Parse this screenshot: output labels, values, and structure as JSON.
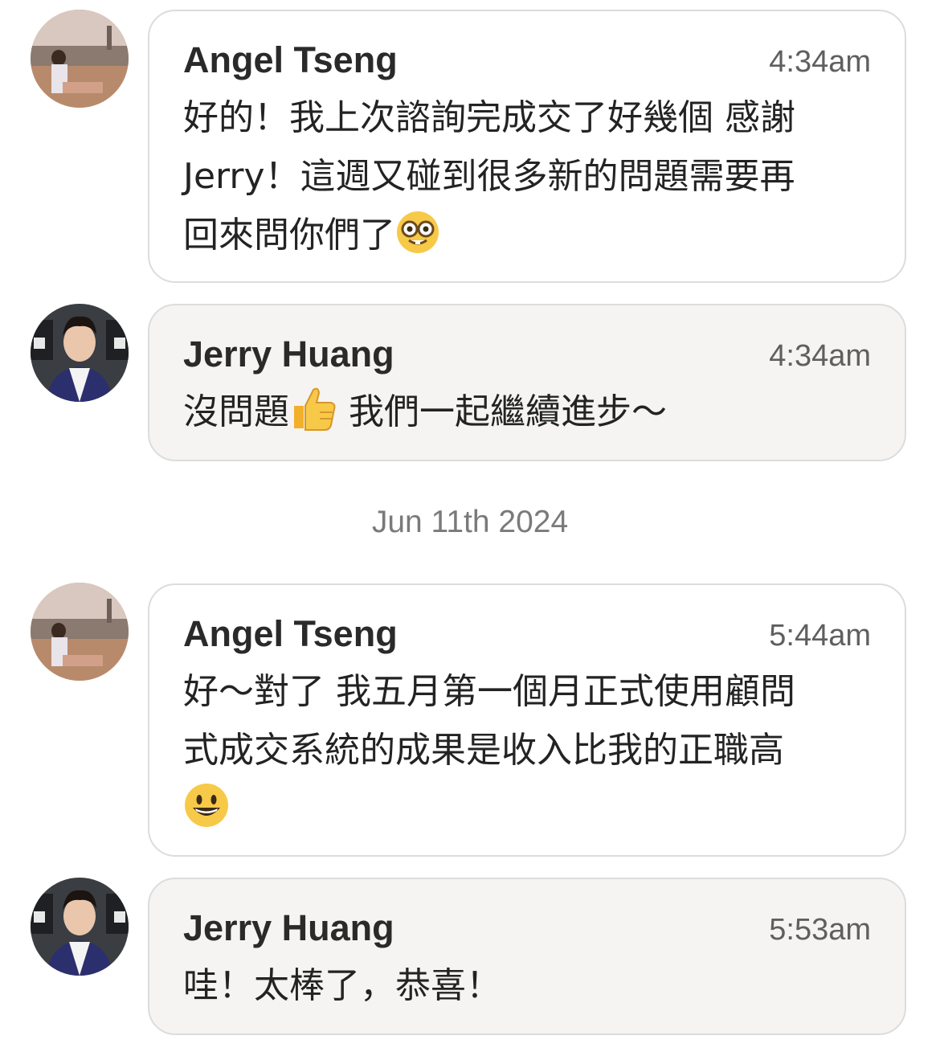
{
  "messages": [
    {
      "sender": "Angel Tseng",
      "time": "4:34am",
      "lines": [
        "好的！我上次諮詢完成交了好幾個 感謝",
        "Jerry！這週又碰到很多新的問題需要再",
        "回來問你們了"
      ],
      "emoji": "nerd-face-emoji"
    },
    {
      "sender": "Jerry Huang",
      "time": "4:34am",
      "text_before": "沒問題",
      "emoji": "thumbs-up-emoji",
      "text_after": " 我們一起繼續進步～"
    },
    {
      "sender": "Angel Tseng",
      "time": "5:44am",
      "lines": [
        "好～對了 我五月第一個月正式使用顧問",
        "式成交系統的成果是收入比我的正職高"
      ],
      "emoji": "grinning-face-emoji"
    },
    {
      "sender": "Jerry Huang",
      "time": "5:53am",
      "text": "哇！太棒了，恭喜！"
    }
  ],
  "date_separator": "Jun 11th 2024",
  "colors": {
    "incoming_bubble": "#ffffff",
    "outgoing_bubble": "#f5f4f2",
    "bubble_border": "#dcdcdc",
    "name": "#2a2a2a",
    "time": "#5f5f5f",
    "date": "#7a7a7a"
  }
}
